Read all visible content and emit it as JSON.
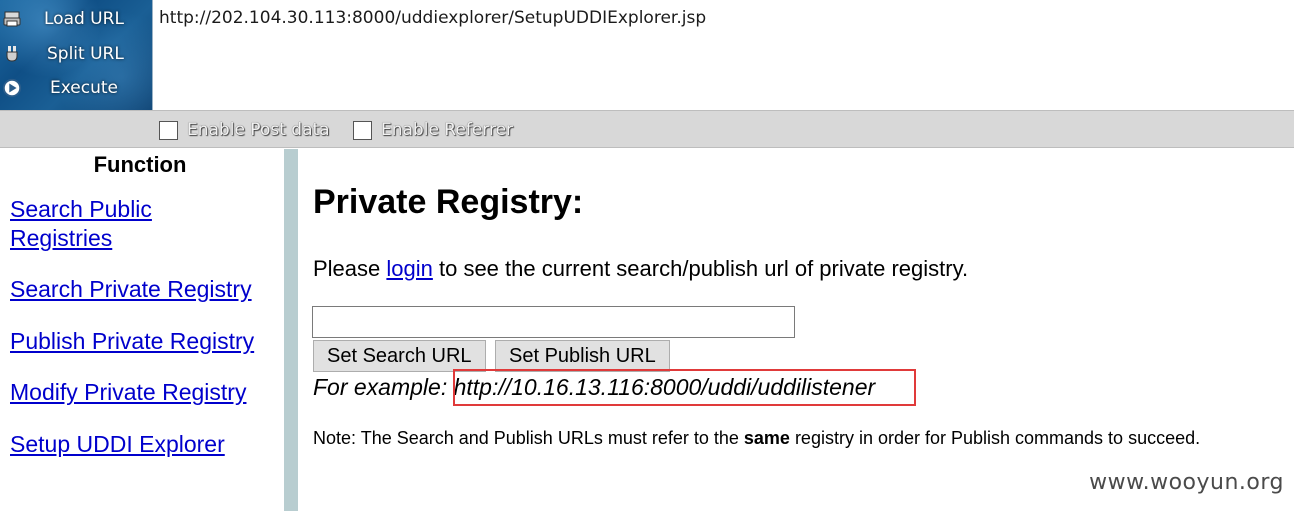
{
  "hackbar": {
    "menu": [
      {
        "label": "Load URL",
        "icon": "load-url-icon"
      },
      {
        "label": "Split URL",
        "icon": "split-url-icon"
      },
      {
        "label": "Execute",
        "icon": "execute-icon"
      }
    ],
    "url_value": "http://202.104.30.113:8000/uddiexplorer/SetupUDDIExplorer.jsp",
    "options": {
      "enable_post_data": "Enable Post data",
      "enable_referrer": "Enable Referrer"
    }
  },
  "sidebar": {
    "title": "Function",
    "links": [
      "Search Public Registries",
      "Search Private Registry",
      "Publish Private Registry",
      "Modify Private Registry",
      "Setup UDDI Explorer"
    ],
    "link_line1": "Search Public",
    "link_line2": "Registries"
  },
  "main": {
    "heading": "Private Registry:",
    "login_prefix": "Please ",
    "login_link": "login",
    "login_suffix": " to see the current search/publish url of private registry.",
    "input_value": "",
    "set_search_button": "Set Search URL",
    "set_publish_button": "Set Publish URL",
    "example_prefix": "For example: ",
    "example_url": "http://10.16.13.116:8000/uddi/uddilistener",
    "note_prefix": "Note: The Search and Publish URLs must refer to the ",
    "note_bold": "same",
    "note_suffix": " registry in order for Publish commands to succeed."
  },
  "watermark": "www.wooyun.org",
  "colors": {
    "link": "#0000cc",
    "highlight_border": "#e03a3a",
    "divider": "#b8cdd0",
    "toolbar_bg": "#0f4f86"
  }
}
